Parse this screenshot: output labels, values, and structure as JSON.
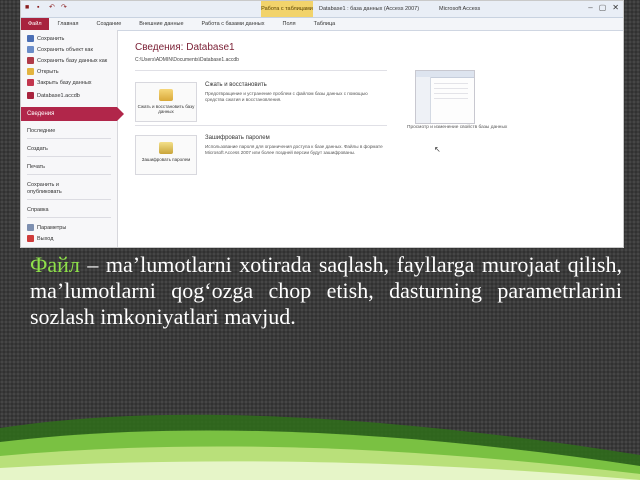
{
  "window": {
    "title": "Database1 : база данных (Access 2007)",
    "app": "Microsoft Access",
    "context_tab": "Работа с таблицами",
    "controls": [
      "–",
      "▢",
      "✕"
    ]
  },
  "ribbon": {
    "tabs": [
      "Файл",
      "Главная",
      "Создание",
      "Внешние данные",
      "Работа с базами данных",
      "Поля",
      "Таблица"
    ]
  },
  "backstage": {
    "commands": [
      {
        "label": "Сохранить",
        "icon": "save-icon"
      },
      {
        "label": "Сохранить объект как",
        "icon": "save-object-icon"
      },
      {
        "label": "Сохранить базу данных как",
        "icon": "save-db-icon"
      },
      {
        "label": "Открыть",
        "icon": "open-folder-icon"
      },
      {
        "label": "Закрыть базу данных",
        "icon": "close-db-icon"
      }
    ],
    "recent_db": "Database1.accdb",
    "selected": "Сведения",
    "sections": [
      {
        "label": "Последние"
      },
      {
        "label": "Создать"
      },
      {
        "label": "Печать"
      },
      {
        "label": "Сохранить и опубликовать"
      },
      {
        "label": "Справка"
      }
    ],
    "bottom_commands": [
      {
        "label": "Параметры",
        "icon": "options-icon"
      },
      {
        "label": "Выход",
        "icon": "exit-icon"
      }
    ]
  },
  "info": {
    "title": "Сведения: Database1",
    "path": "C:\\Users\\ADMIN\\Documents\\Database1.accdb",
    "compact": {
      "button": "Сжать и восстановить базу данных",
      "title": "Сжать и восстановить",
      "text": "Предотвращение и устранение проблем с файлом базы данных с помощью средства сжатия и восстановления."
    },
    "encrypt": {
      "button": "Зашифровать паролем",
      "title": "Зашифровать паролем",
      "text": "Использование пароля для ограничения доступа к базе данных. Файлы в формате Microsoft Access 2007 или более поздней версии будут зашифрованы."
    },
    "preview_caption": "Просмотр и изменение свойств базы данных"
  },
  "caption": {
    "highlight": "Файл",
    "text": " – ma’lumotlarni xotirada saqlash, fayllarga murojaat qilish, ma’lumotlarni qog‘ozga chop etish, dasturning parametrlarini sozlash imkoniyatlari mavjud."
  },
  "colors": {
    "accent": "#b1264a",
    "highlight_text": "#8ee04a",
    "caption_text": "#ffffff",
    "background": "#3a3a3a"
  }
}
